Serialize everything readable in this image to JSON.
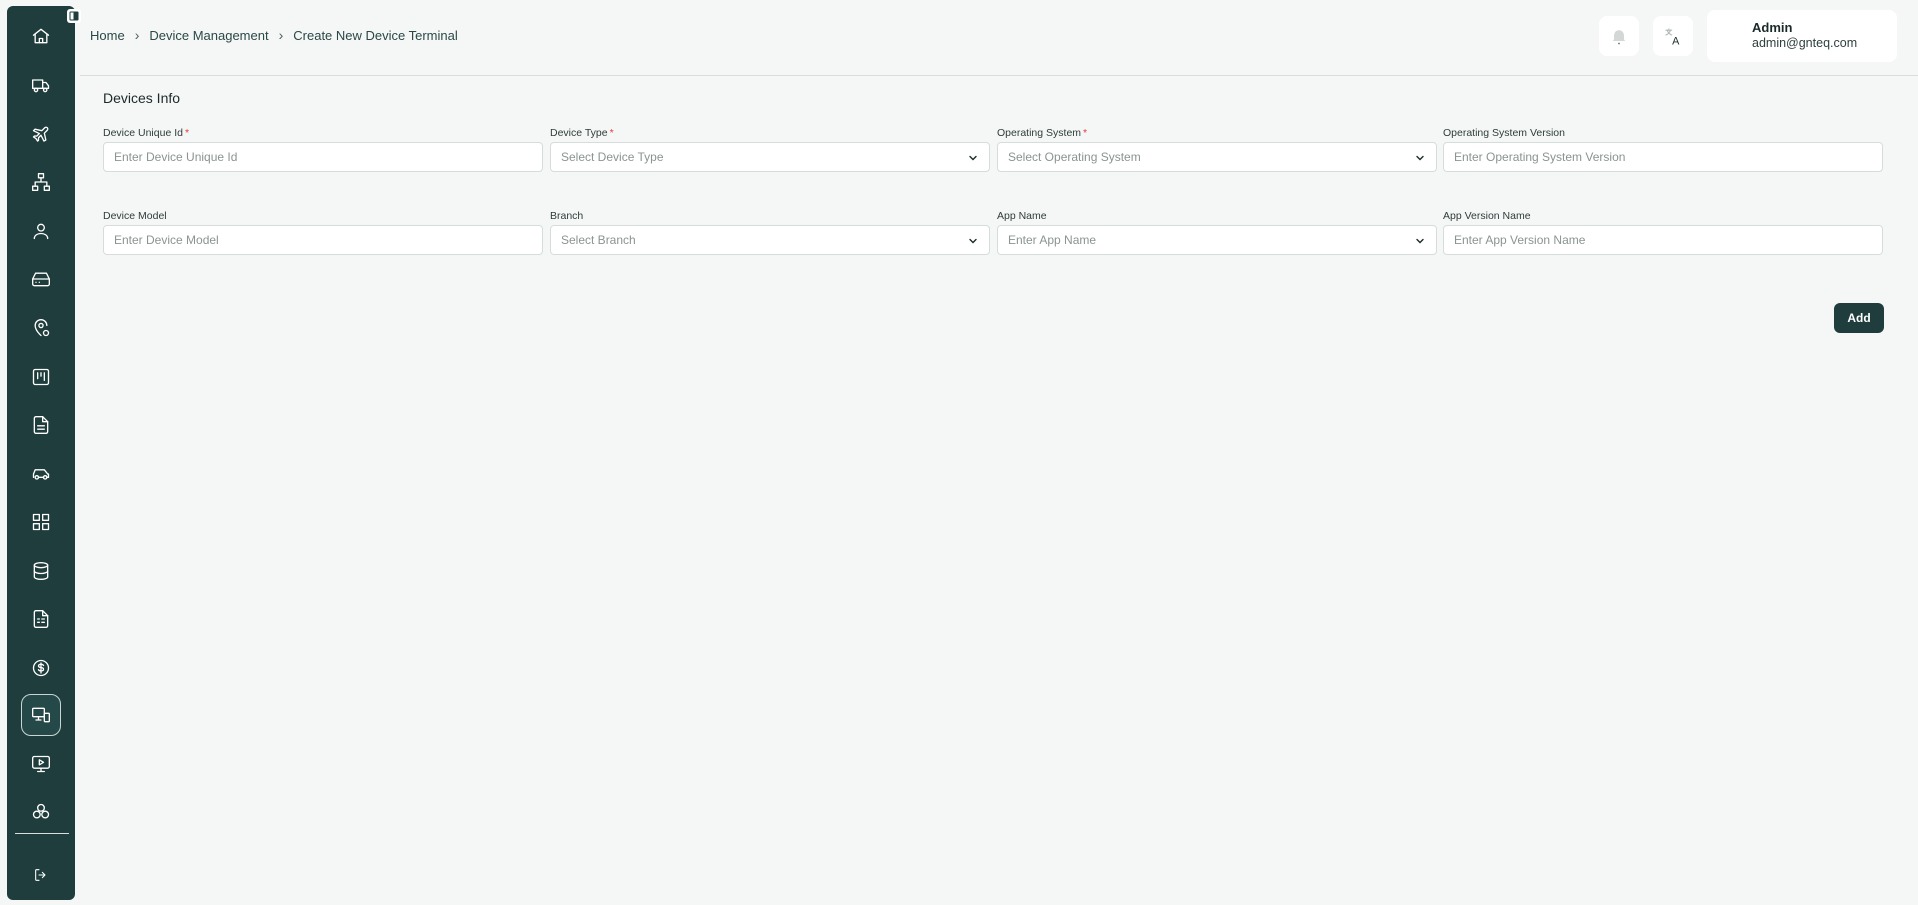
{
  "sidebar": {
    "items": [
      {
        "icon": "home-icon"
      },
      {
        "icon": "truck-icon"
      },
      {
        "icon": "plane-icon"
      },
      {
        "icon": "network-icon"
      },
      {
        "icon": "user-icon"
      },
      {
        "icon": "hard-drive-icon"
      },
      {
        "icon": "location-settings-icon"
      },
      {
        "icon": "kanban-icon"
      },
      {
        "icon": "document-icon"
      },
      {
        "icon": "car-icon"
      },
      {
        "icon": "dashboard-grid-icon"
      },
      {
        "icon": "database-icon"
      },
      {
        "icon": "report-icon"
      },
      {
        "icon": "dollar-icon"
      },
      {
        "icon": "device-terminal-icon",
        "active": true
      },
      {
        "icon": "monitor-play-icon"
      },
      {
        "icon": "cluster-icon"
      }
    ],
    "logout_icon": "logout-icon",
    "colors": {
      "background": "#1e3d3c",
      "accent": "#244948"
    }
  },
  "breadcrumb": {
    "items": [
      "Home",
      "Device Management",
      "Create New Device Terminal"
    ]
  },
  "header": {
    "notification_icon": "bell-icon",
    "language_icon": "translate-icon",
    "user": {
      "name": "Admin",
      "email": "admin@gnteq.com"
    }
  },
  "form": {
    "section_title": "Devices Info",
    "fields": {
      "device_unique_id": {
        "label": "Device Unique Id",
        "required": true,
        "placeholder": "Enter Device Unique Id"
      },
      "device_type": {
        "label": "Device Type",
        "required": true,
        "placeholder": "Select Device Type"
      },
      "operating_system": {
        "label": "Operating System",
        "required": true,
        "placeholder": "Select Operating System"
      },
      "operating_system_version": {
        "label": "Operating System Version",
        "placeholder": "Enter Operating System Version"
      },
      "device_model": {
        "label": "Device Model",
        "placeholder": "Enter Device Model"
      },
      "branch": {
        "label": "Branch",
        "placeholder": "Select Branch"
      },
      "app_name": {
        "label": "App Name",
        "placeholder": "Enter App Name"
      },
      "app_version_name": {
        "label": "App Version Name",
        "placeholder": "Enter App Version Name"
      }
    },
    "required_marker": "*",
    "add_label": "Add"
  }
}
